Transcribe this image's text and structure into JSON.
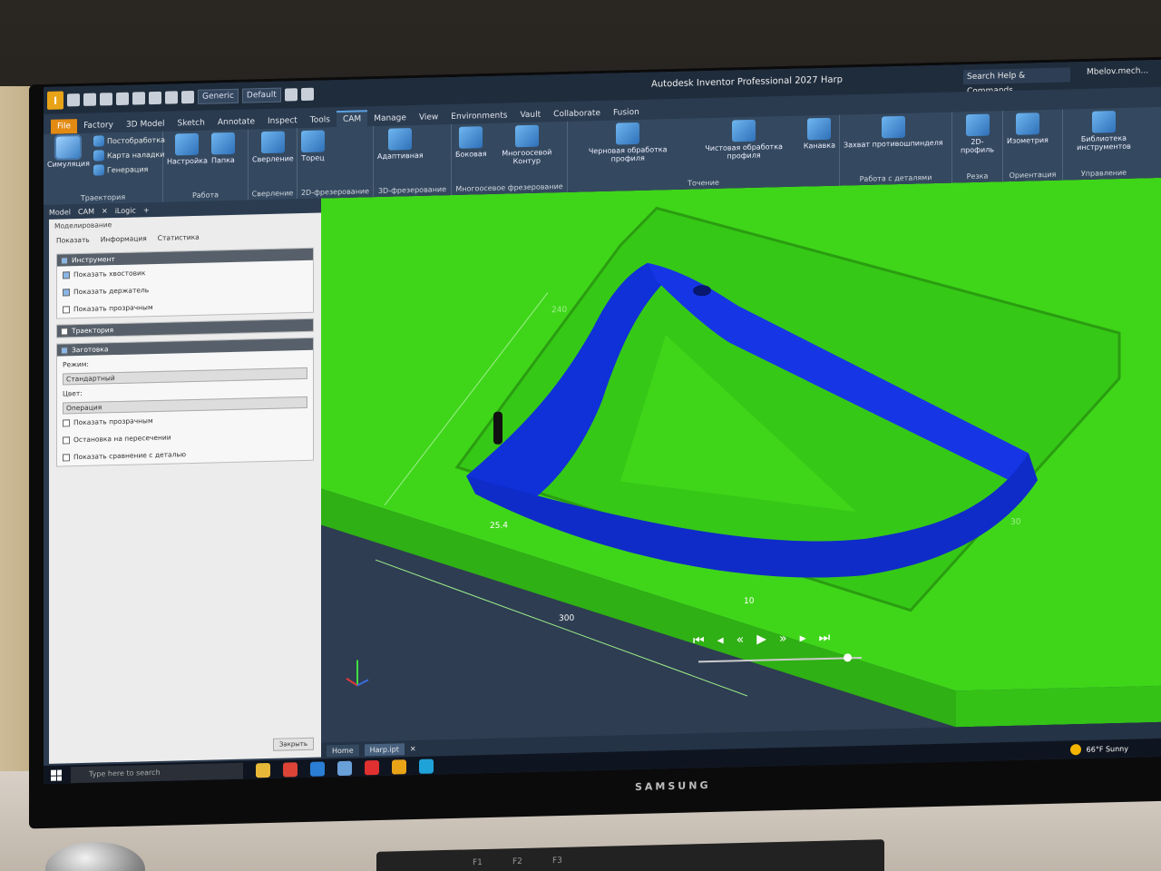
{
  "titlebar": {
    "app_logo": "I",
    "appearance_value": "Generic",
    "material_value": "Default",
    "title": "Autodesk Inventor Professional 2027   Harp",
    "search_placeholder": "Search Help & Commands...",
    "user": "Mbelov.mech..."
  },
  "tabs": [
    {
      "label": "File"
    },
    {
      "label": "Factory"
    },
    {
      "label": "3D Model"
    },
    {
      "label": "Sketch"
    },
    {
      "label": "Annotate"
    },
    {
      "label": "Inspect"
    },
    {
      "label": "Tools"
    },
    {
      "label": "CAM"
    },
    {
      "label": "Manage"
    },
    {
      "label": "View"
    },
    {
      "label": "Environments"
    },
    {
      "label": "Vault"
    },
    {
      "label": "Collaborate"
    },
    {
      "label": "Fusion"
    }
  ],
  "ribbon": {
    "simulation": "Симуляция",
    "postprocess": "Постобработка",
    "setup_sheet": "Карта наладки",
    "generate": "Генерация",
    "group_toolpath": "Траектория",
    "setup": "Настройка",
    "folder": "Папка",
    "group_job": "Работа",
    "drilling": "Сверление",
    "group_drilling": "Сверление",
    "facing": "Торец",
    "group_2d": "2D-фрезерование",
    "adaptive": "Адаптивная",
    "group_3d": "3D-фрезерование",
    "swarf": "Боковая",
    "multiaxis_contour": "Многоосевой Контур",
    "group_multiaxis": "Многоосевое фрезерование",
    "profile_roughing": "Черновая обработка профиля",
    "profile_finishing": "Чистовая обработка профиля",
    "groove": "Канавка",
    "group_turning": "Точение",
    "sub_spindle_grab": "Захват противошпинделя",
    "group_parts": "Работа с деталями",
    "profile_2d": "2D-профиль",
    "group_cutting": "Резка",
    "isometric": "Изометрия",
    "group_orientation": "Ориентация",
    "tool_library": "Библиотека инструментов",
    "group_manage": "Управление"
  },
  "browser": {
    "tabs": [
      "Model",
      "CAM",
      "iLogic"
    ],
    "panel_title": "Моделирование",
    "subtabs": [
      "Показать",
      "Информация",
      "Статистика"
    ],
    "tool_section": "Инструмент",
    "show_shank": "Показать хвостовик",
    "show_holder": "Показать держатель",
    "show_transparent": "Показать прозрачным",
    "toolpath_section": "Траектория",
    "stock_section": "Заготовка",
    "mode_label": "Режим:",
    "mode_value": "Стандартный",
    "color_label": "Цвет:",
    "color_value": "Операция",
    "stock_transparent": "Показать прозрачным",
    "stop_on_collision": "Остановка на пересечении",
    "compare_with_part": "Показать сравнение с деталью",
    "close": "Закрыть"
  },
  "viewport": {
    "dims": {
      "d240": "240",
      "d300": "300",
      "d254": "25.4",
      "d10": "10",
      "d30": "30"
    },
    "colors": {
      "stock": "#3fd61a",
      "part": "#1030d8",
      "background": "#2e3d52"
    }
  },
  "doctabs": {
    "home": "Home",
    "file": "Harp.ipt"
  },
  "taskbar": {
    "search_placeholder": "Type here to search",
    "weather": "66°F  Sunny"
  },
  "monitor_brand": "SAMSUNG"
}
